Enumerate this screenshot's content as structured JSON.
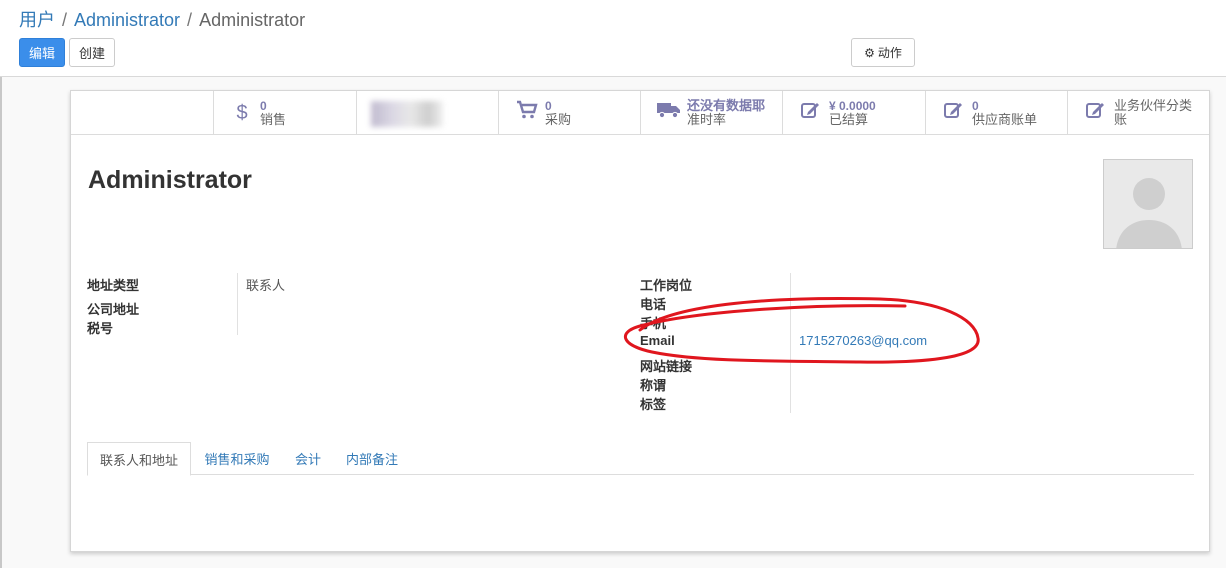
{
  "breadcrumb": {
    "root": "用户",
    "parent": "Administrator",
    "current": "Administrator",
    "separator": "/"
  },
  "toolbar": {
    "edit_label": "编辑",
    "create_label": "创建",
    "action_label": "动作",
    "action_icon": "gear-icon"
  },
  "smart_buttons": [
    {
      "icon": "dollar-icon",
      "value": "0",
      "label": "销售"
    },
    {
      "icon": "redacted",
      "value": "",
      "label": ""
    },
    {
      "icon": "cart-icon",
      "value": "0",
      "label": "采购"
    },
    {
      "icon": "truck-icon",
      "value": "还没有数据耶",
      "label": "准时率"
    },
    {
      "icon": "edit-icon",
      "value": "¥ 0.0000",
      "label": "已结算"
    },
    {
      "icon": "edit-icon",
      "value": "0",
      "label": "供应商账单"
    },
    {
      "icon": "edit-icon",
      "value": "",
      "label": "业务伙伴分类",
      "label2": "账"
    }
  ],
  "record": {
    "name": "Administrator"
  },
  "left_fields": [
    {
      "label": "地址类型",
      "value": "联系人"
    },
    {
      "label": "公司地址",
      "value": ""
    },
    {
      "label": "税号",
      "value": ""
    }
  ],
  "right_fields": [
    {
      "label": "工作岗位",
      "value": ""
    },
    {
      "label": "电话",
      "value": ""
    },
    {
      "label": "手机",
      "value": ""
    },
    {
      "label": "Email",
      "value": "1715270263@qq.com"
    },
    {
      "label": "网站链接",
      "value": ""
    },
    {
      "label": "称谓",
      "value": ""
    },
    {
      "label": "标签",
      "value": ""
    }
  ],
  "tabs": [
    {
      "label": "联系人和地址",
      "active": true
    },
    {
      "label": "销售和采购",
      "active": false
    },
    {
      "label": "会计",
      "active": false
    },
    {
      "label": "内部备注",
      "active": false
    }
  ],
  "colors": {
    "primary": "#3b8eea",
    "link": "#337ab7",
    "stat_accent": "#7c7bad",
    "annotation": "#e0161e"
  }
}
